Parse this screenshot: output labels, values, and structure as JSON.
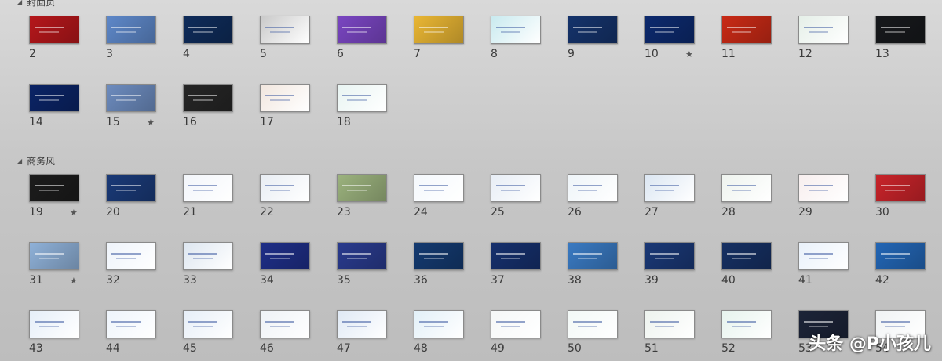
{
  "sections": [
    {
      "title": "封面页",
      "rows": [
        {
          "slides": [
            {
              "num": "2",
              "star": false,
              "color": "#b5171b",
              "light": false
            },
            {
              "num": "3",
              "star": false,
              "color": "#5e88c9",
              "light": false
            },
            {
              "num": "4",
              "star": false,
              "color": "#0f2c5a",
              "light": false
            },
            {
              "num": "5",
              "star": false,
              "color": "#c9c9c9",
              "light": true
            },
            {
              "num": "6",
              "star": false,
              "color": "#7a46c2",
              "light": false
            },
            {
              "num": "7",
              "star": false,
              "color": "#e9b634",
              "light": false
            },
            {
              "num": "8",
              "star": false,
              "color": "#c9eaef",
              "light": true
            },
            {
              "num": "9",
              "star": false,
              "color": "#15336b",
              "light": false
            },
            {
              "num": "10",
              "star": true,
              "color": "#0d2a6e",
              "light": false
            },
            {
              "num": "11",
              "star": false,
              "color": "#c92a16",
              "light": false
            },
            {
              "num": "12",
              "star": false,
              "color": "#e5efe8",
              "light": true
            },
            {
              "num": "13",
              "star": false,
              "color": "#17191c",
              "light": false
            }
          ]
        },
        {
          "slides": [
            {
              "num": "14",
              "star": false,
              "color": "#0b2466",
              "light": false
            },
            {
              "num": "15",
              "star": true,
              "color": "#6d8cbf",
              "light": false
            },
            {
              "num": "16",
              "star": false,
              "color": "#262626",
              "light": false
            },
            {
              "num": "17",
              "star": false,
              "color": "#f1e6de",
              "light": true
            },
            {
              "num": "18",
              "star": false,
              "color": "#e8f4f2",
              "light": true
            }
          ]
        }
      ]
    },
    {
      "title": "商务风",
      "rows": [
        {
          "slides": [
            {
              "num": "19",
              "star": true,
              "color": "#1c1c1c",
              "light": false
            },
            {
              "num": "20",
              "star": false,
              "color": "#1a3a78",
              "light": false
            },
            {
              "num": "21",
              "star": false,
              "color": "#f2f5fa",
              "light": true
            },
            {
              "num": "22",
              "star": false,
              "color": "#e8edf3",
              "light": true
            },
            {
              "num": "23",
              "star": false,
              "color": "#9cb37e",
              "light": false
            },
            {
              "num": "24",
              "star": false,
              "color": "#f4f8fc",
              "light": true
            },
            {
              "num": "25",
              "star": false,
              "color": "#e7edf5",
              "light": true
            },
            {
              "num": "26",
              "star": false,
              "color": "#eef4f8",
              "light": true
            },
            {
              "num": "27",
              "star": false,
              "color": "#dbe6f2",
              "light": true
            },
            {
              "num": "28",
              "star": false,
              "color": "#eef3ee",
              "light": true
            },
            {
              "num": "29",
              "star": false,
              "color": "#f7eeee",
              "light": true
            },
            {
              "num": "30",
              "star": false,
              "color": "#c9242a",
              "light": false
            }
          ]
        },
        {
          "slides": [
            {
              "num": "31",
              "star": true,
              "color": "#8fb1d8",
              "light": false
            },
            {
              "num": "32",
              "star": false,
              "color": "#eef3fa",
              "light": true
            },
            {
              "num": "33",
              "star": false,
              "color": "#dde6f0",
              "light": true
            },
            {
              "num": "34",
              "star": false,
              "color": "#1f2f88",
              "light": false
            },
            {
              "num": "35",
              "star": false,
              "color": "#2a3b8e",
              "light": false
            },
            {
              "num": "36",
              "star": false,
              "color": "#143a70",
              "light": false
            },
            {
              "num": "37",
              "star": false,
              "color": "#16306d",
              "light": false
            },
            {
              "num": "38",
              "star": false,
              "color": "#3a7ac2",
              "light": false
            },
            {
              "num": "39",
              "star": false,
              "color": "#1a3876",
              "light": false
            },
            {
              "num": "40",
              "star": false,
              "color": "#163063",
              "light": false
            },
            {
              "num": "41",
              "star": false,
              "color": "#e9f1fa",
              "light": true
            },
            {
              "num": "42",
              "star": false,
              "color": "#2366b5",
              "light": false
            }
          ]
        },
        {
          "slides": [
            {
              "num": "43",
              "star": false,
              "color": "#e5eef8",
              "light": true
            },
            {
              "num": "44",
              "star": false,
              "color": "#eef4fb",
              "light": true
            },
            {
              "num": "45",
              "star": false,
              "color": "#e6eef7",
              "light": true
            },
            {
              "num": "46",
              "star": false,
              "color": "#eef2f6",
              "light": true
            },
            {
              "num": "47",
              "star": false,
              "color": "#dfe9f5",
              "light": true
            },
            {
              "num": "48",
              "star": false,
              "color": "#e2f0f8",
              "light": true
            },
            {
              "num": "49",
              "star": false,
              "color": "#f5f7f7",
              "light": true
            },
            {
              "num": "50",
              "star": false,
              "color": "#f2f8f6",
              "light": true
            },
            {
              "num": "51",
              "star": false,
              "color": "#edf3ee",
              "light": true
            },
            {
              "num": "52",
              "star": false,
              "color": "#e6f3ed",
              "light": true
            },
            {
              "num": "53",
              "star": false,
              "color": "#1c2438",
              "light": false
            },
            {
              "num": "54",
              "star": false,
              "color": "#f0f3f4",
              "light": true
            }
          ]
        }
      ]
    }
  ],
  "star_glyph": "★",
  "collapse_glyph": "◢",
  "watermark": "头条 @P小孩儿"
}
